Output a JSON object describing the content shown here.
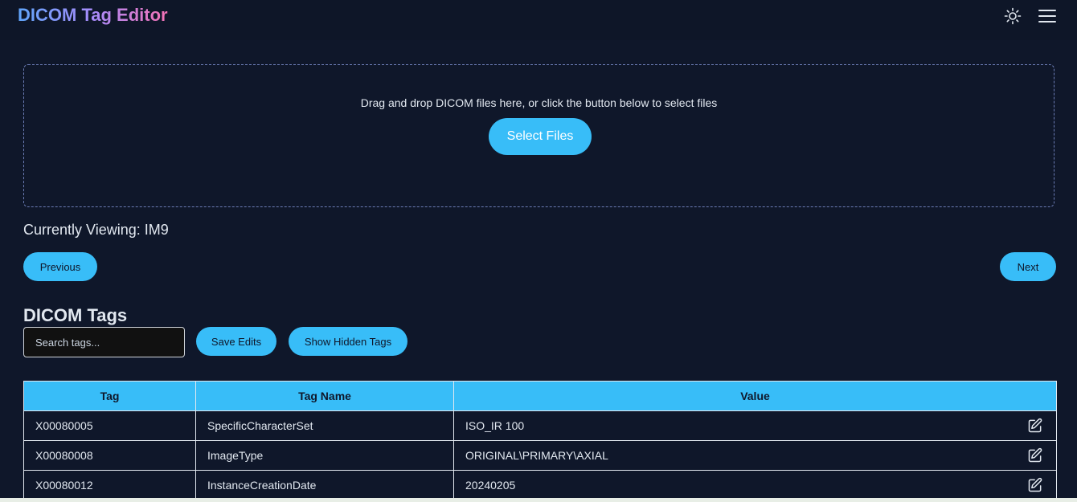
{
  "header": {
    "title": "DICOM Tag Editor",
    "theme_icon": "sun-icon",
    "menu_icon": "hamburger-menu-icon"
  },
  "dropzone": {
    "instruction": "Drag and drop DICOM files here, or click the button below to select files",
    "select_button": "Select Files"
  },
  "viewer": {
    "current_label": "Currently Viewing: IM9",
    "previous_button": "Previous",
    "next_button": "Next"
  },
  "tags_section": {
    "title": "DICOM Tags",
    "search_placeholder": "Search tags...",
    "save_button": "Save Edits",
    "hidden_button": "Show Hidden Tags"
  },
  "table": {
    "headers": [
      "Tag",
      "Tag Name",
      "Value"
    ],
    "rows": [
      {
        "tag": "X00080005",
        "name": "SpecificCharacterSet",
        "value": "ISO_IR 100"
      },
      {
        "tag": "X00080008",
        "name": "ImageType",
        "value": "ORIGINAL\\PRIMARY\\AXIAL"
      },
      {
        "tag": "X00080012",
        "name": "InstanceCreationDate",
        "value": "20240205"
      }
    ],
    "edit_icon": "edit-pencil-icon"
  },
  "colors": {
    "background": "#0f172a",
    "accent": "#38bdf8",
    "title_gradient": [
      "#60a5fa",
      "#a78bfa",
      "#f472b6"
    ]
  }
}
